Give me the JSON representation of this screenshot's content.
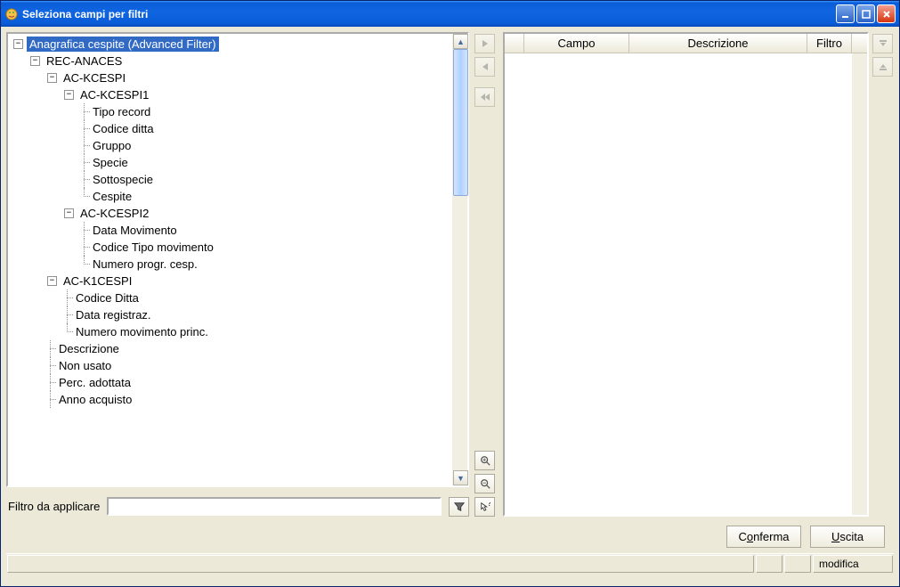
{
  "window": {
    "title": "Seleziona campi per filtri"
  },
  "tree": {
    "root": "Anagrafica cespite (Advanced Filter)",
    "n1": "REC-ANACES",
    "n2": "AC-KCESPI",
    "n3": "AC-KCESPI1",
    "n3_1": "Tipo record",
    "n3_2": "Codice ditta",
    "n3_3": "Gruppo",
    "n3_4": "Specie",
    "n3_5": "Sottospecie",
    "n3_6": "Cespite",
    "n4": "AC-KCESPI2",
    "n4_1": "Data Movimento",
    "n4_2": "Codice Tipo movimento",
    "n4_3": "Numero progr. cesp.",
    "n5": "AC-K1CESPI",
    "n5_1": "Codice Ditta",
    "n5_2": "Data registraz.",
    "n5_3": "Numero movimento princ.",
    "n6": "Descrizione",
    "n7": "Non usato",
    "n8": "Perc. adottata",
    "n9": "Anno acquisto"
  },
  "grid": {
    "col1": "Campo",
    "col2": "Descrizione",
    "col3": "Filtro"
  },
  "filter": {
    "label": "Filtro da applicare",
    "value": ""
  },
  "buttons": {
    "confirm_pre": "C",
    "confirm_u": "o",
    "confirm_post": "nferma",
    "exit_u": "U",
    "exit_post": "scita"
  },
  "status": {
    "mode": "modifica"
  }
}
